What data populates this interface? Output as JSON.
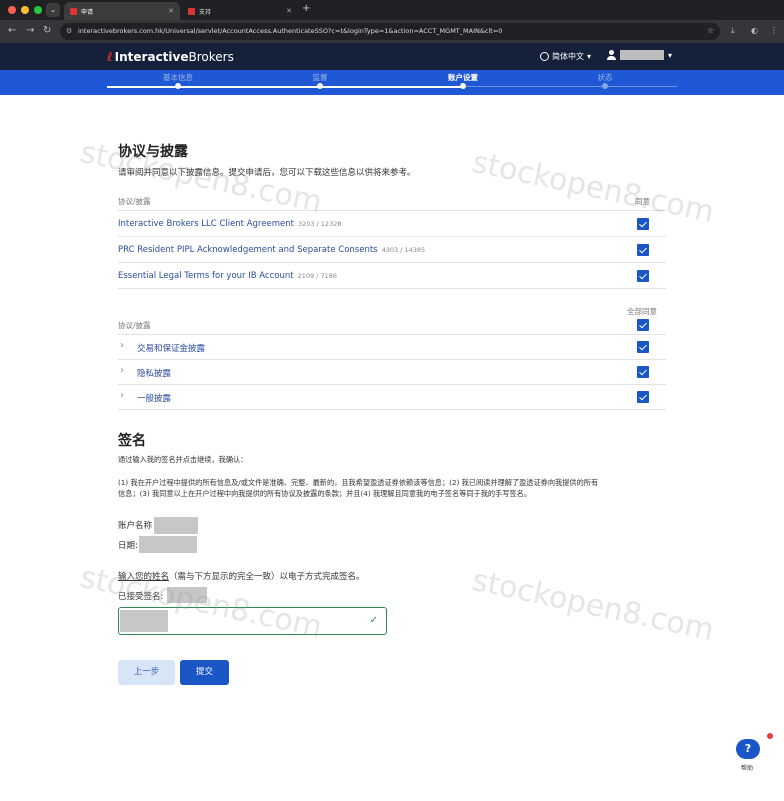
{
  "browser": {
    "tabs": [
      {
        "label": "申请"
      },
      {
        "label": "支持"
      }
    ],
    "url": "interactivebrokers.com.hk/Universal/servlet/AccountAccess.AuthenticateSSO?c=t&loginType=1&action=ACCT_MGMT_MAIN&clt=0"
  },
  "header": {
    "logo_bold": "Interactive",
    "logo_thin": "Brokers",
    "language": "简体中文"
  },
  "steps": [
    {
      "label": "基本信息"
    },
    {
      "label": "监督"
    },
    {
      "label": "账户设置"
    },
    {
      "label": "状态"
    }
  ],
  "agreements": {
    "title": "协议与披露",
    "intro": "请审阅并同意以下披露信息。提交申请后，您可以下载这些信息以供将来参考。",
    "col_left": "协议/披露",
    "col_right": "同意",
    "items": [
      {
        "name": "Interactive Brokers LLC Client Agreement",
        "count": "3203 / 12328"
      },
      {
        "name": "PRC Resident PIPL Acknowledgement and Separate Consents",
        "count": "4303 / 14385"
      },
      {
        "name": "Essential Legal Terms for your IB Account",
        "count": "2109 / 7186"
      }
    ],
    "group_col_left": "协议/披露",
    "group_col_right": "全部同意",
    "groups": [
      {
        "name": "交易和保证金披露"
      },
      {
        "name": "隐私披露"
      },
      {
        "name": "一般披露"
      }
    ]
  },
  "signature": {
    "title": "签名",
    "confirm_intro": "通过输入我的签名并点击继续，我确认：",
    "confirm_line1": "(1) 我在开户过程中提供的所有信息及/或文件是准确、完整、最新的，且我希望盈透证券依赖该等信息；(2) 我已阅读并理解了盈透证券向我提供的所有",
    "confirm_line2": "信息；(3) 我同意以上在开户过程中向我提供的所有协议及披露的条款；并且(4) 我理解且同意我的电子签名等同于我的手写签名。",
    "account_label": "账户名称",
    "date_label": "日期:",
    "instr_link": "输入您的姓名",
    "instr_rest": "（需与下方显示的完全一致）以电子方式完成签名。",
    "accepted_label": "已接受签名:"
  },
  "buttons": {
    "prev": "上一步",
    "submit": "提交"
  },
  "help": {
    "label": "帮助"
  },
  "watermark": "stockopen8.com"
}
